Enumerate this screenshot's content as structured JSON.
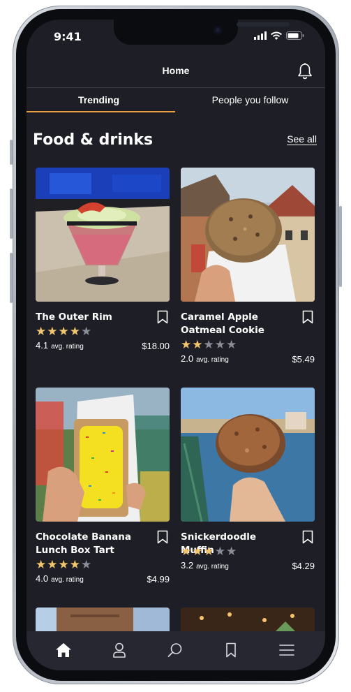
{
  "status_bar": {
    "time": "9:41"
  },
  "header": {
    "title": "Home"
  },
  "tabs": [
    {
      "label": "Trending",
      "active": true
    },
    {
      "label": "People you follow",
      "active": false
    }
  ],
  "section": {
    "title": "Food & drinks",
    "see_all_label": "See all"
  },
  "cards": [
    {
      "name": "The Outer Rim",
      "stars": 4,
      "rating": "4.1",
      "rating_caption": "avg. rating",
      "price": "$18.00",
      "photo": "cocktail-photo"
    },
    {
      "name": "Caramel Apple Oatmeal Cookie",
      "stars": 2,
      "rating": "2.0",
      "rating_caption": "avg. rating",
      "price": "$5.49",
      "photo": "cookie-photo"
    },
    {
      "name": "Chocolate Banana Lunch Box Tart",
      "stars": 4,
      "rating": "4.0",
      "rating_caption": "avg. rating",
      "price": "$4.99",
      "photo": "tart-photo"
    },
    {
      "name": "Snickerdoodle Muffin",
      "stars": 3,
      "rating": "3.2",
      "rating_caption": "avg. rating",
      "price": "$4.29",
      "photo": "muffin-photo"
    }
  ],
  "colors": {
    "accent": "#e8a13b",
    "star": "#f2c46d",
    "background": "#1d1e26"
  },
  "bottom_nav": [
    "home-icon",
    "profile-icon",
    "search-icon",
    "bookmark-icon",
    "menu-icon"
  ]
}
